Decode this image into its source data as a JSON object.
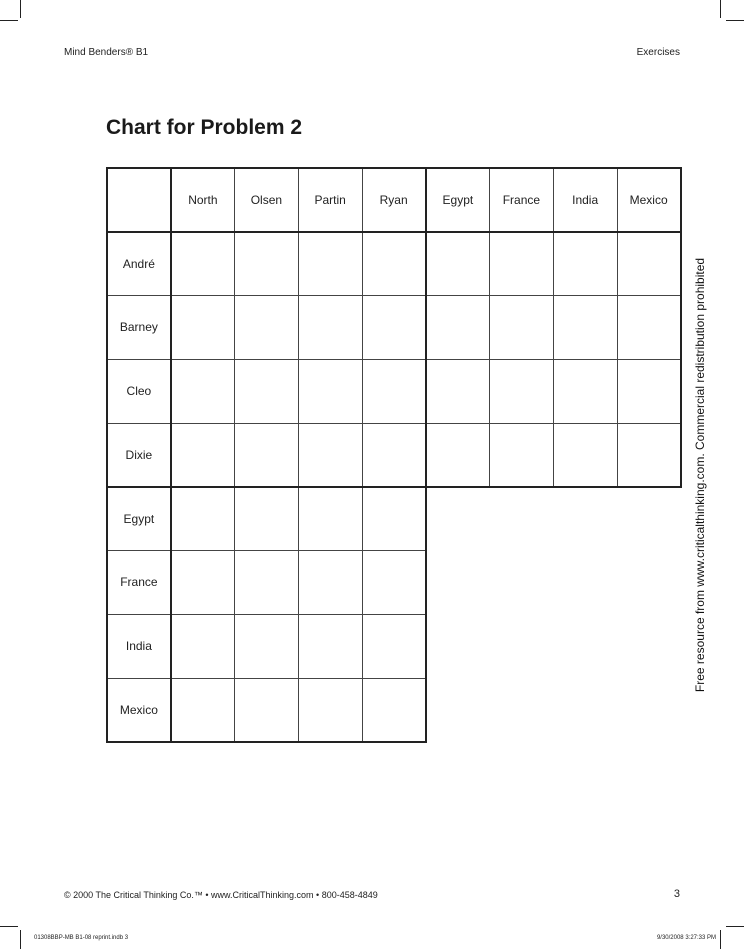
{
  "header": {
    "left": "Mind Benders® B1",
    "right": "Exercises"
  },
  "title": "Chart for Problem 2",
  "grid": {
    "column_headers": [
      "North",
      "Olsen",
      "Partin",
      "Ryan",
      "Egypt",
      "France",
      "India",
      "Mexico"
    ],
    "row_headers": [
      "André",
      "Barney",
      "Cleo",
      "Dixie",
      "Egypt",
      "France",
      "India",
      "Mexico"
    ]
  },
  "side_note": "Free resource from www.criticalthinking.com. Commercial redistribution prohibited",
  "footer": {
    "copyright": "© 2000 The Critical Thinking Co.™ • www.CriticalThinking.com • 800-458-4849",
    "page_number": "3"
  },
  "slug": {
    "left": "01308BBP-MB B1-08 reprint.indb   3",
    "right": "9/30/2008   3:27:33 PM"
  }
}
